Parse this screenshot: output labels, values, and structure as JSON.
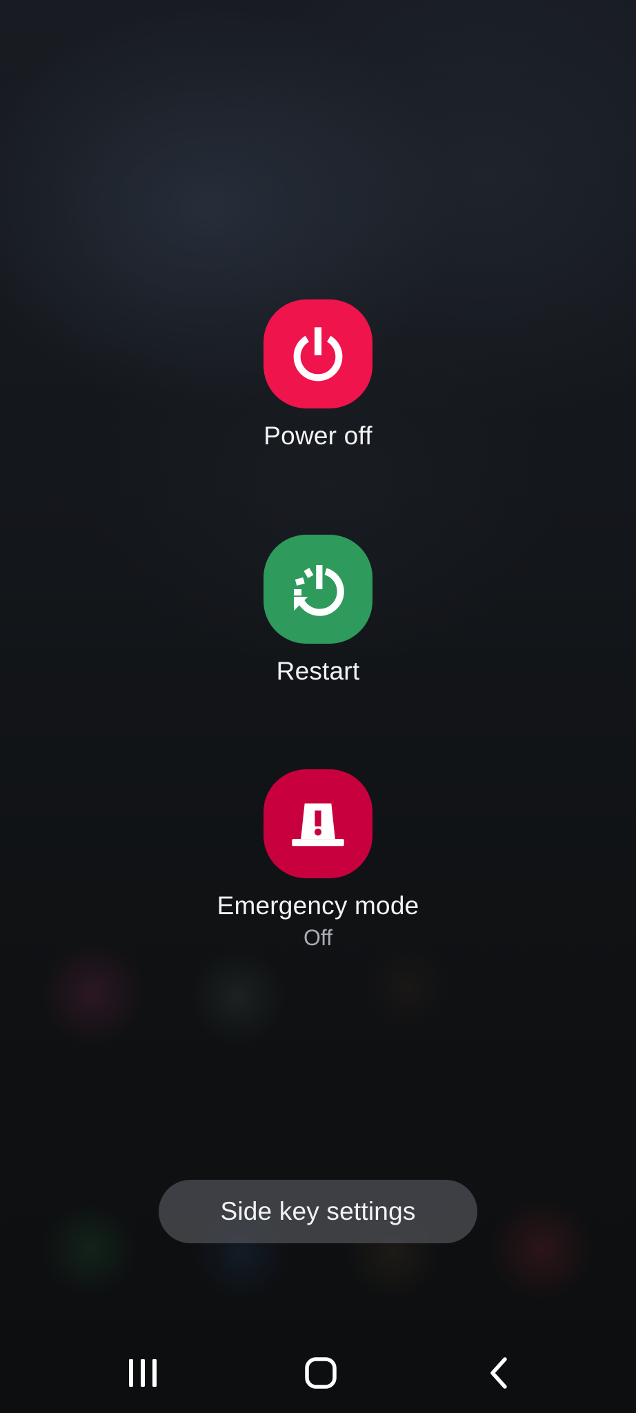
{
  "power_menu": {
    "power_off": {
      "label": "Power off",
      "icon": "power-icon",
      "color": "#f0144c"
    },
    "restart": {
      "label": "Restart",
      "icon": "restart-icon",
      "color": "#2e9a5c"
    },
    "emergency_mode": {
      "label": "Emergency mode",
      "status": "Off",
      "icon": "emergency-light-icon",
      "color": "#c8003e"
    }
  },
  "side_key_settings": {
    "label": "Side key settings"
  },
  "nav_bar": {
    "recents_icon": "recents-icon",
    "home_icon": "home-icon",
    "back_icon": "back-icon"
  }
}
